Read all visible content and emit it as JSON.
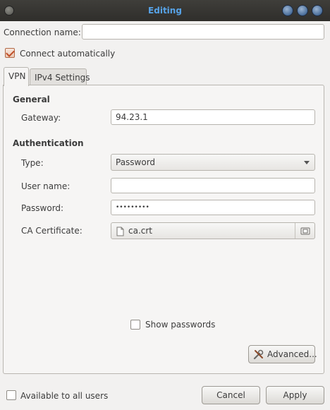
{
  "window": {
    "title": "Editing"
  },
  "connection_name": {
    "label": "Connection name:",
    "value": ""
  },
  "connect_automatically": {
    "label": "Connect automatically",
    "checked": true
  },
  "tabs": [
    {
      "label": "VPN",
      "active": true
    },
    {
      "label": "IPv4 Settings",
      "active": false
    }
  ],
  "general": {
    "heading": "General",
    "gateway_label": "Gateway:",
    "gateway_value": "94.23.1"
  },
  "authentication": {
    "heading": "Authentication",
    "type_label": "Type:",
    "type_value": "Password",
    "username_label": "User name:",
    "username_value": "",
    "password_label": "Password:",
    "password_value": "•••••••••",
    "ca_label": "CA Certificate:",
    "ca_value": "ca.crt"
  },
  "show_passwords": {
    "label": "Show passwords",
    "checked": false
  },
  "advanced_button": "Advanced...",
  "available_all_users": {
    "label": "Available to all users",
    "checked": false
  },
  "cancel_button": "Cancel",
  "apply_button": "Apply",
  "colors": {
    "title": "#57a3e8",
    "titlebar": "#3a3935",
    "checkbox_accent": "#c0502a"
  }
}
